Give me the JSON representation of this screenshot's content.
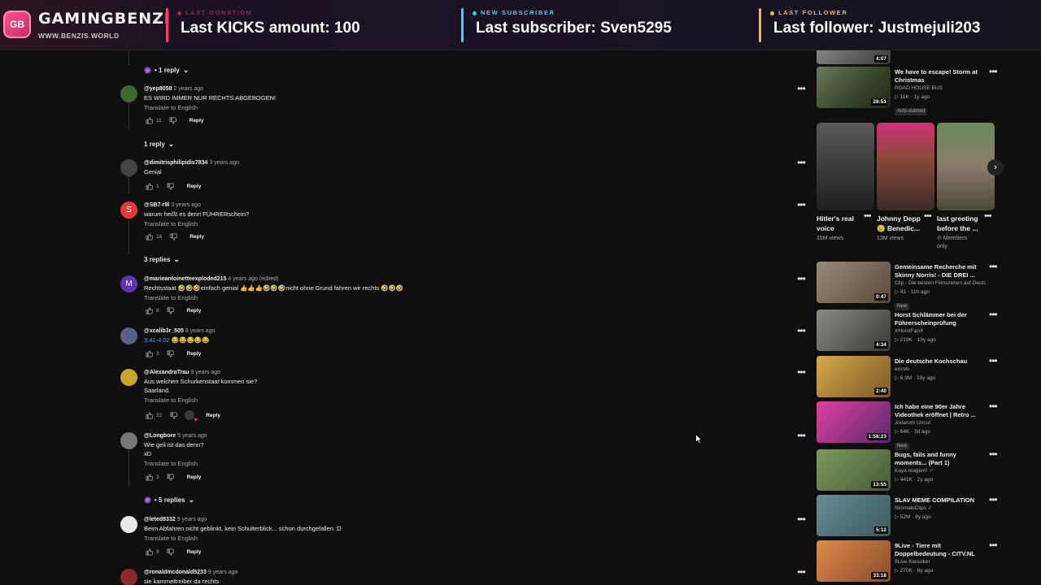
{
  "overlay": {
    "brand": {
      "logo_text": "GB",
      "name": "GAMINGBENZI",
      "url": "WWW.BENZIS.WORLD"
    },
    "segments": [
      {
        "label": "LAST DONATION",
        "value": "Last KICKS amount: 100",
        "color": "#ff3b6b"
      },
      {
        "label": "NEW SUBSCRIBER",
        "value": "Last subscriber: Sven5295",
        "color": "#38d4ff"
      },
      {
        "label": "LAST FOLLOWER",
        "value": "Last follower: Justmejuli203",
        "color": "#ffb347"
      }
    ]
  },
  "comments": {
    "toggles": [
      {
        "label": "• 1 reply"
      },
      {
        "label": "1 reply"
      },
      {
        "label": "3 replies"
      },
      {
        "label": "• 5 replies"
      }
    ],
    "items": [
      {
        "handle": "@yep8058",
        "time": "2 years ago",
        "text": "ES WIRD IMMER NUR RECHTS ABGEBOGEN!",
        "translate": "Translate to English",
        "likes": "11",
        "reply": "Reply",
        "avatar_color": "#3a6b2a",
        "avatar_letter": ""
      },
      {
        "handle": "@dimitrisphilipidis7834",
        "time": "3 years ago",
        "text": "Genial",
        "translate": "",
        "likes": "1",
        "reply": "Reply",
        "avatar_color": "#444444",
        "avatar_letter": ""
      },
      {
        "handle": "@SB7-r9l",
        "time": "3 years ago",
        "text": "warum heißt es denn FÜHRERschein?",
        "translate": "Translate to English",
        "likes": "16",
        "reply": "Reply",
        "avatar_color": "#e53935",
        "avatar_letter": "S"
      },
      {
        "handle": "@marieantoinetteexploded215",
        "time": "4 years ago (edited)",
        "text": "Rechtsstaat 🤣🤣🤣einfach genial 👍👍👍🤣🤣🤣nicht ohne Grund fahren wir rechts 🤣🤣🤣",
        "translate": "Translate to English",
        "likes": "8",
        "reply": "Reply",
        "avatar_color": "#5e35b1",
        "avatar_letter": "M"
      },
      {
        "handle": "@xcalib3r_505",
        "time": "8 years ago",
        "text_ts": "3:41-4:02",
        "text": " 😂😂😂😂😂",
        "translate": "",
        "likes": "3",
        "reply": "Reply",
        "avatar_color": "#5b5f8a",
        "avatar_letter": ""
      },
      {
        "handle": "@AlexandraTrau",
        "time": "9 years ago",
        "text": "Aus welchen Schurkenstaat kommen sie?\nSaarland.",
        "translate": "Translate to English",
        "likes": "22",
        "reply": "Reply",
        "avatar_color": "#c8a82c",
        "avatar_letter": ""
      },
      {
        "handle": "@Longbore",
        "time": "9 years ago",
        "text": "Wie geil ist das denn?\nxD",
        "translate": "Translate to English",
        "likes": "3",
        "reply": "Reply",
        "avatar_color": "#777777",
        "avatar_letter": ""
      },
      {
        "handle": "@leted9332",
        "time": "9 years ago",
        "text": "Beim Abfahren nicht geblinkt, kein Schulterblick... schon durchgefallen :D",
        "translate": "Translate to English",
        "likes": "9",
        "reply": "Reply",
        "avatar_color": "#e8e8e8",
        "avatar_letter": ""
      },
      {
        "handle": "@ronaldmcdonald5233",
        "time": "9 years ago",
        "text": "sie kammeltreiber da rechts",
        "translate": "",
        "likes": "",
        "reply": "",
        "avatar_color": "#8a2a2a",
        "avatar_letter": ""
      }
    ]
  },
  "sidebar": {
    "videos_top": [
      {
        "title": "",
        "channel": "",
        "meta": "",
        "duration": "4:07",
        "thumb_color": "#6b6b6b"
      },
      {
        "title": "We have to escape! Storm at Christmas",
        "channel": "ROAD HOUSE BUS",
        "meta": "▷ 11K · 1y ago",
        "badge": "Auto-dubbed",
        "duration": "28:51",
        "thumb_color": "#4b5a3a"
      }
    ],
    "shorts": [
      {
        "title": "Hitler's real voice",
        "views": "15M views",
        "thumb_color": "#3a3a3a"
      },
      {
        "title": "Johnny Depp 😢 Benedic...",
        "views": "13M views",
        "thumb_color": "#8a3a5e"
      },
      {
        "title": "last greeting before the ...",
        "views": "⊙ Members only",
        "thumb_color": "#6a7a5a"
      }
    ],
    "videos": [
      {
        "title": "Gemeinsame Recherche mit Skinny Norris! - DIE DREI ...",
        "channel": "Clip - Die besten Filmszenen auf Deutsch •",
        "meta": "▷ 41 · 11h ago",
        "badge": "New",
        "duration": "0:47",
        "thumb_color": "#7a6a5a"
      },
      {
        "title": "Horst Schlämmer bei der Führerscheinprüfung",
        "channel": "XHorstFanX",
        "meta": "▷ 219K · 19y ago",
        "badge": "",
        "duration": "4:34",
        "thumb_color": "#5a5a55"
      },
      {
        "title": "Die deutsche Kochschau",
        "channel": "ertcvb",
        "meta": "▷ 6.9M · 19y ago",
        "badge": "",
        "duration": "2:40",
        "thumb_color": "#b88a3a"
      },
      {
        "title": "Ich habe eine 90er Jahre Videothek eröffnet | Retro ...",
        "channel": "Jodarum Uncut",
        "meta": "▷ 64K · 3d ago",
        "badge": "New",
        "duration": "1:58:23",
        "thumb_color": "#c23a9a"
      },
      {
        "title": "Bugs, fails and funny moments... (Part 1)",
        "channel": "Kaya reagiert! ✓",
        "meta": "▷ 441K · 2y ago",
        "badge": "",
        "duration": "13:55",
        "thumb_color": "#6a8a4a"
      },
      {
        "title": "SLAV MEME COMPILATION",
        "channel": "NicimakiClips ✓",
        "meta": "▷ 52M · 8y ago",
        "badge": "",
        "duration": "5:12",
        "thumb_color": "#5a7a8a"
      },
      {
        "title": "9Live - Tiere mit Doppelbedeutung - CITV.NL",
        "channel": "9Live Klassiker",
        "meta": "▷ 270K · 6y ago",
        "badge": "",
        "duration": "33:18",
        "thumb_color": "#c86a3a"
      }
    ]
  }
}
